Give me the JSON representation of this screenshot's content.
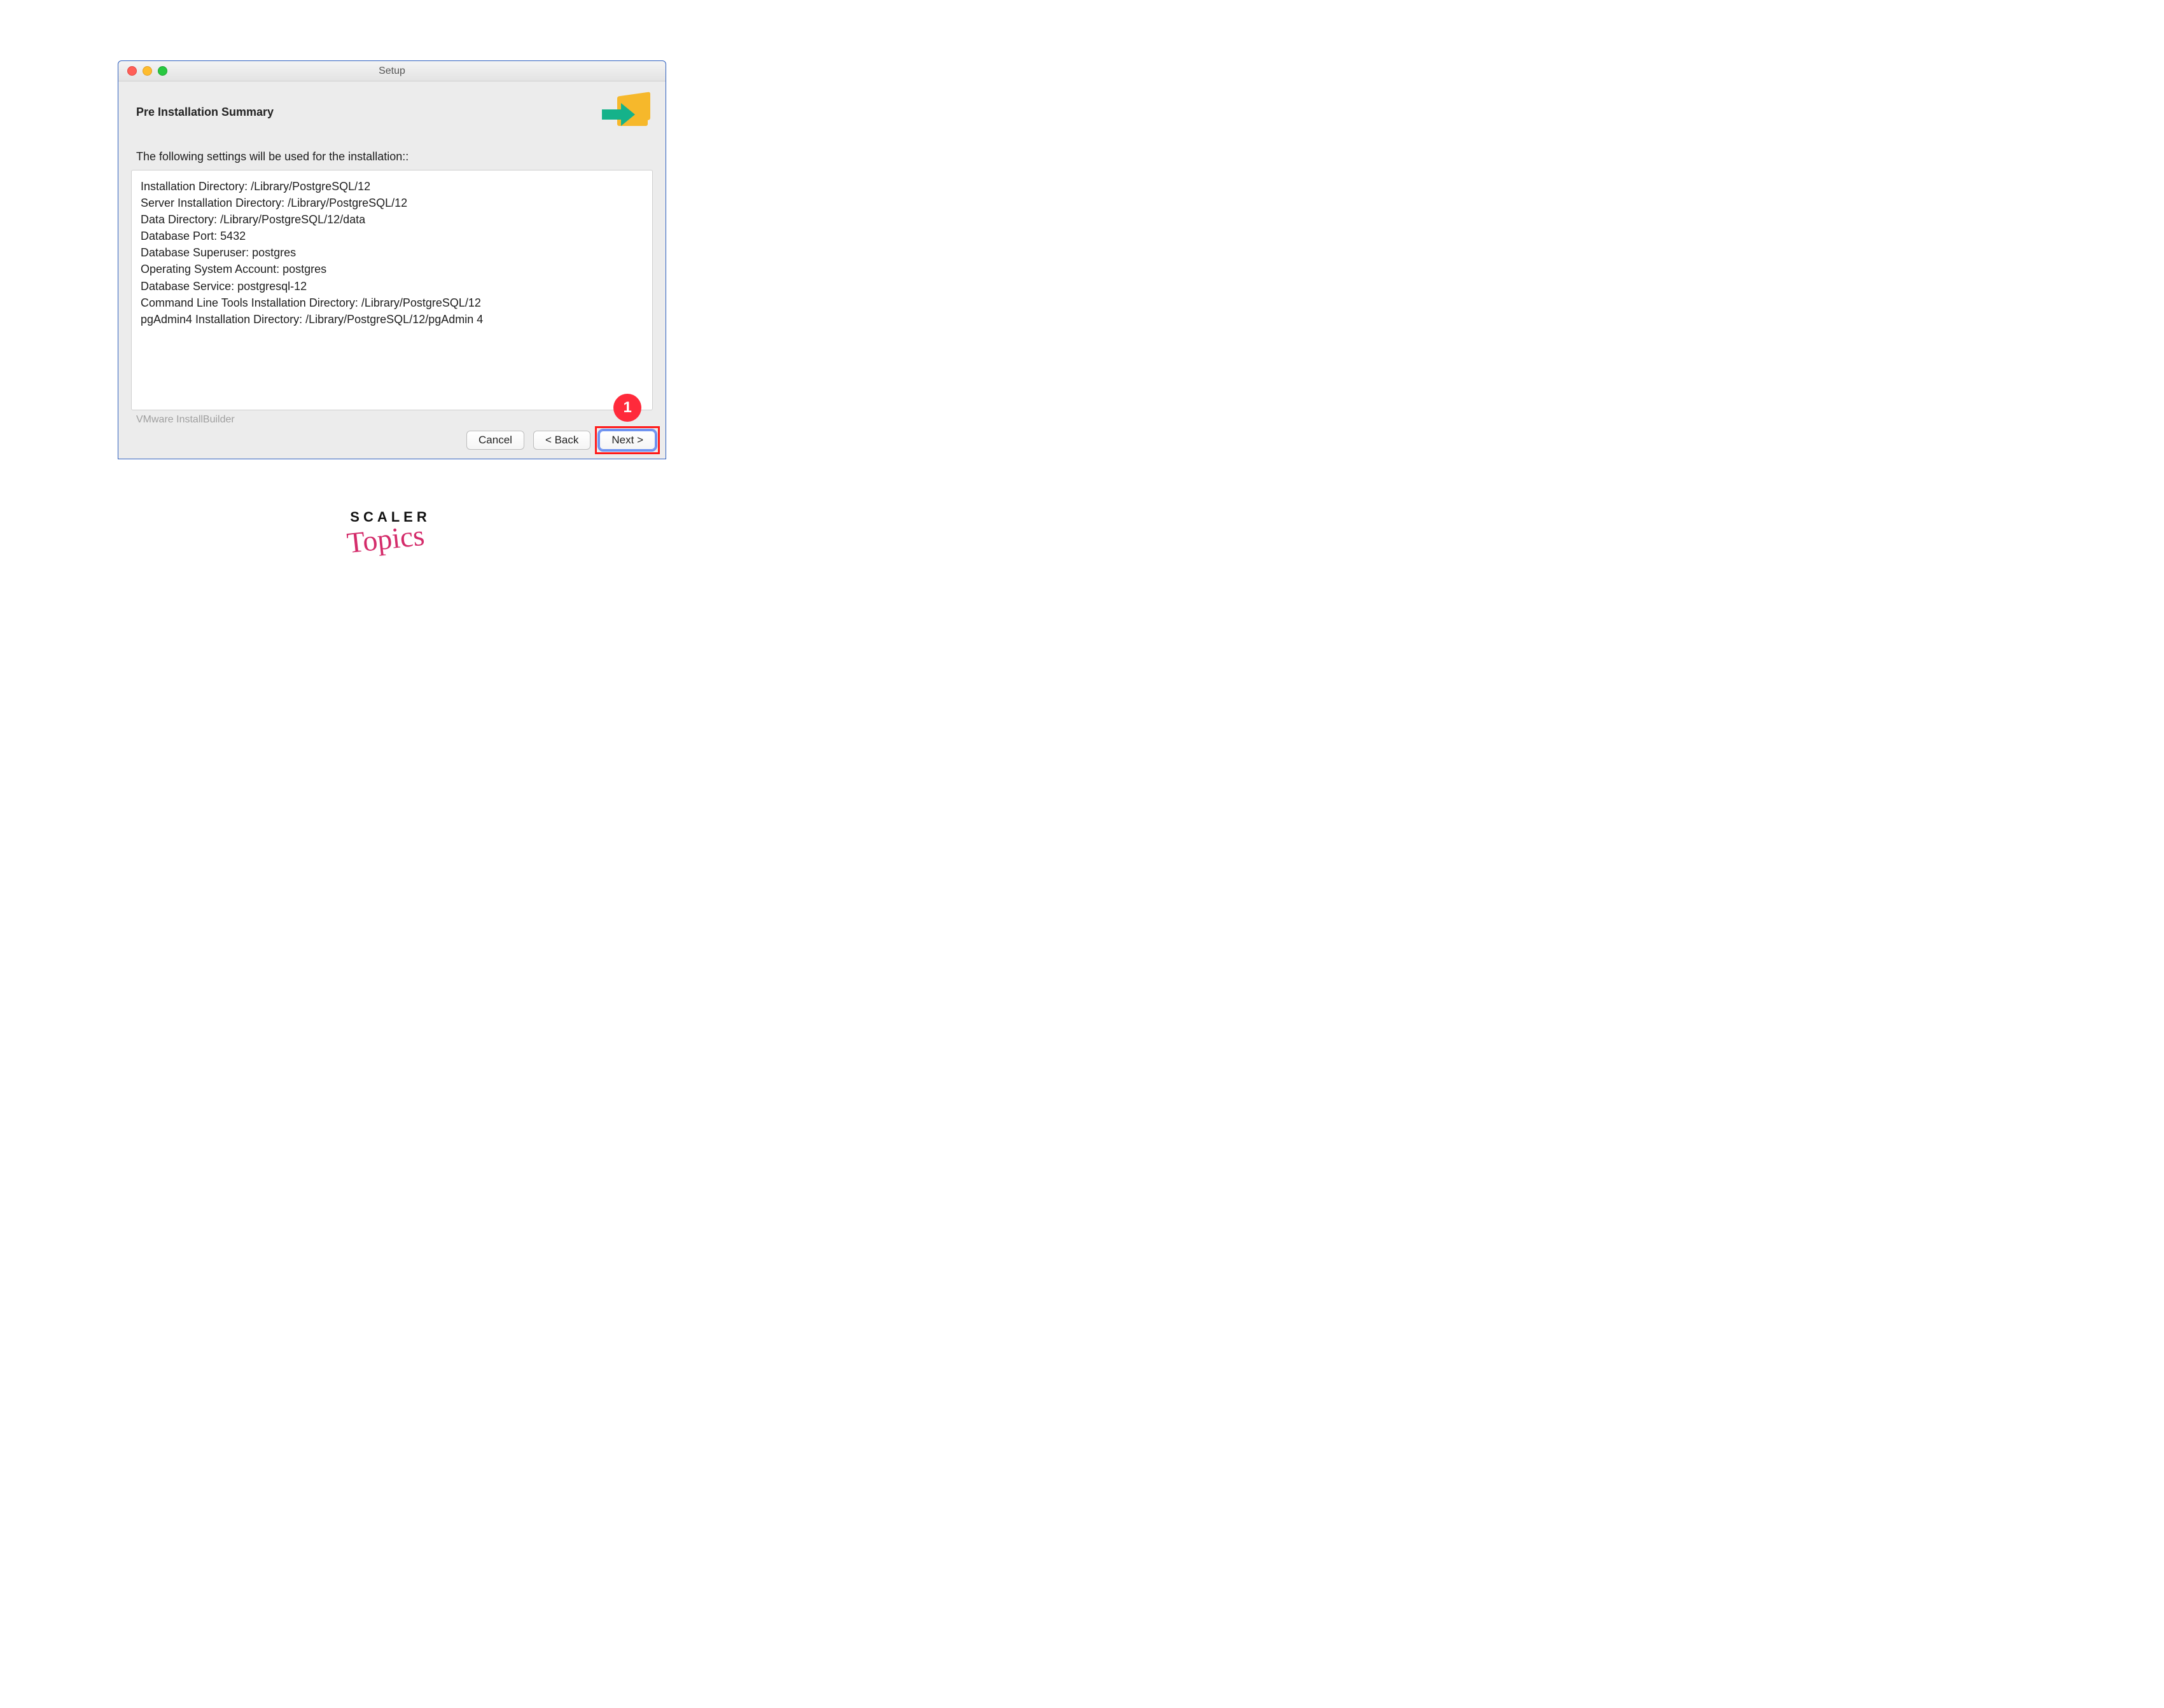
{
  "window": {
    "title": "Setup",
    "heading": "Pre Installation Summary",
    "intro": "The following settings will be used for the installation::",
    "summary_lines": [
      "Installation Directory: /Library/PostgreSQL/12",
      "Server Installation Directory: /Library/PostgreSQL/12",
      "Data Directory: /Library/PostgreSQL/12/data",
      "Database Port: 5432",
      "Database Superuser: postgres",
      "Operating System Account: postgres",
      "Database Service: postgresql-12",
      "Command Line Tools Installation Directory: /Library/PostgreSQL/12",
      "pgAdmin4 Installation Directory: /Library/PostgreSQL/12/pgAdmin 4"
    ],
    "footer": "VMware InstallBuilder",
    "buttons": {
      "cancel": "Cancel",
      "back": "< Back",
      "next": "Next >"
    }
  },
  "annotation": {
    "callout_number": "1"
  },
  "brand": {
    "line1": "SCALER",
    "line2": "Topics"
  }
}
